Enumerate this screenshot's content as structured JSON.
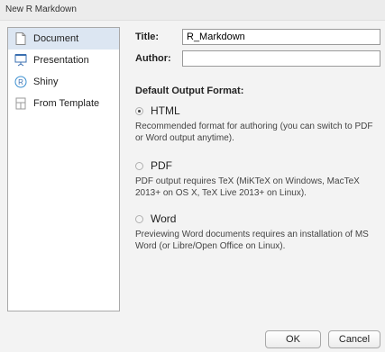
{
  "window": {
    "title": "New R Markdown"
  },
  "sidebar": {
    "items": [
      {
        "label": "Document",
        "icon": "document-icon",
        "selected": true
      },
      {
        "label": "Presentation",
        "icon": "presentation-icon",
        "selected": false
      },
      {
        "label": "Shiny",
        "icon": "shiny-icon",
        "selected": false
      },
      {
        "label": "From Template",
        "icon": "template-icon",
        "selected": false
      }
    ]
  },
  "form": {
    "title_label": "Title:",
    "title_value": "R_Markdown",
    "author_label": "Author:",
    "author_value": ""
  },
  "output": {
    "section_title": "Default Output Format:",
    "options": [
      {
        "label": "HTML",
        "checked": true,
        "description": "Recommended format for authoring (you can switch to PDF or Word output anytime)."
      },
      {
        "label": "PDF",
        "checked": false,
        "description": "PDF output requires TeX (MiKTeX on Windows, MacTeX 2013+ on OS X, TeX Live 2013+ on Linux)."
      },
      {
        "label": "Word",
        "checked": false,
        "description": "Previewing Word documents requires an installation of MS Word (or Libre/Open Office on Linux)."
      }
    ]
  },
  "buttons": {
    "ok": "OK",
    "cancel": "Cancel"
  },
  "colors": {
    "selection": "#dce6f2",
    "background": "#f3f3f3"
  }
}
